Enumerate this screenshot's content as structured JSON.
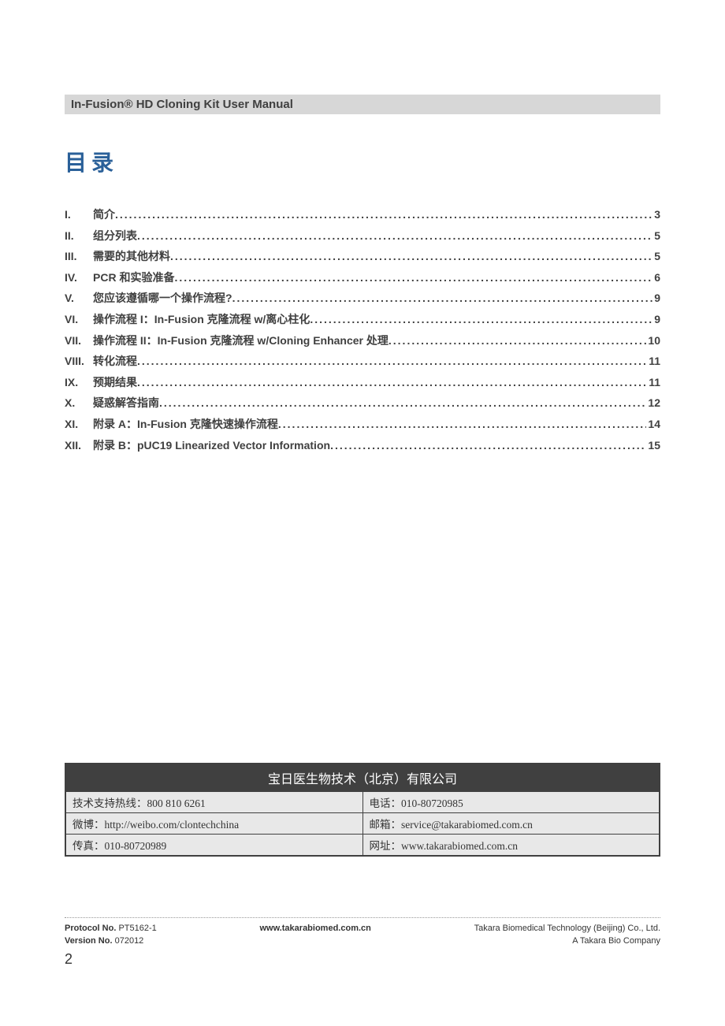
{
  "header": {
    "title": "In-Fusion® HD Cloning Kit User Manual"
  },
  "toc": {
    "title": "目录",
    "items": [
      {
        "num": "I.",
        "label": "简介",
        "page": "3"
      },
      {
        "num": "II.",
        "label": "组分列表",
        "page": "5"
      },
      {
        "num": "III.",
        "label": "需要的其他材料",
        "page": "5"
      },
      {
        "num": "IV.",
        "label": "PCR 和实验准备",
        "page": "6"
      },
      {
        "num": "V.",
        "label": "您应该遵循哪一个操作流程?",
        "page": "9"
      },
      {
        "num": "VI.",
        "label": "操作流程 I：In-Fusion 克隆流程 w/离心柱化",
        "page": "9"
      },
      {
        "num": "VII.",
        "label": "操作流程 II：In-Fusion 克隆流程 w/Cloning Enhancer 处理",
        "page": "10"
      },
      {
        "num": "VIII.",
        "label": "转化流程",
        "page": "11"
      },
      {
        "num": "IX.",
        "label": "预期结果",
        "page": "11"
      },
      {
        "num": "X.",
        "label": "疑惑解答指南",
        "page": "12"
      },
      {
        "num": "XI.",
        "label": "附录 A：In-Fusion 克隆快速操作流程",
        "page": "14"
      },
      {
        "num": "XII.",
        "label": "附录 B：pUC19 Linearized Vector Information",
        "page": "15"
      }
    ]
  },
  "contact": {
    "company": "宝日医生物技术（北京）有限公司",
    "rows": [
      {
        "left_label": "技术支持热线：",
        "left_value": "800 810 6261",
        "right_label": "电话：",
        "right_value": "010-80720985"
      },
      {
        "left_label": "微博：",
        "left_value": "http://weibo.com/clontechchina",
        "right_label": "邮箱：",
        "right_value": "service@takarabiomed.com.cn"
      },
      {
        "left_label": "传真：",
        "left_value": "010-80720989",
        "right_label": "网址：",
        "right_value": "www.takarabiomed.com.cn"
      }
    ]
  },
  "footer": {
    "protocol_label": "Protocol No.",
    "protocol_value": "PT5162-1",
    "version_label": "Version No.",
    "version_value": "072012",
    "center": "www.takarabiomed.com.cn",
    "right_line1": "Takara Biomedical Technology (Beijing) Co., Ltd.",
    "right_line2": "A Takara Bio Company",
    "page_number": "2"
  }
}
